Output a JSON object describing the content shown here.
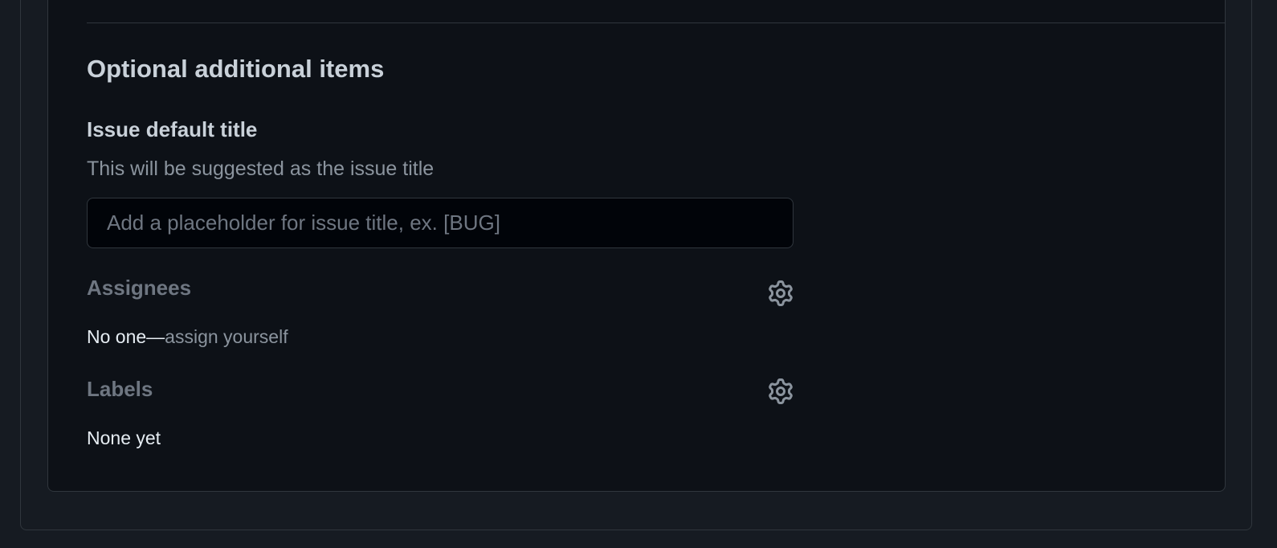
{
  "section": {
    "title": "Optional additional items"
  },
  "issue_title": {
    "label": "Issue default title",
    "help": "This will be suggested as the issue title",
    "value": "",
    "placeholder": "Add a placeholder for issue title, ex. [BUG]"
  },
  "assignees": {
    "heading": "Assignees",
    "icon": "gear-icon",
    "value_prefix": "No one—",
    "assign_link": "assign yourself"
  },
  "labels": {
    "heading": "Labels",
    "icon": "gear-icon",
    "value": "None yet"
  },
  "colors": {
    "page_background": "#161b22",
    "panel_background": "#0d1117",
    "input_background": "#010409",
    "border": "#30363d",
    "heading_text": "#c9d1d9",
    "muted_text": "#8b949e",
    "disabled_heading": "#6e7681"
  }
}
